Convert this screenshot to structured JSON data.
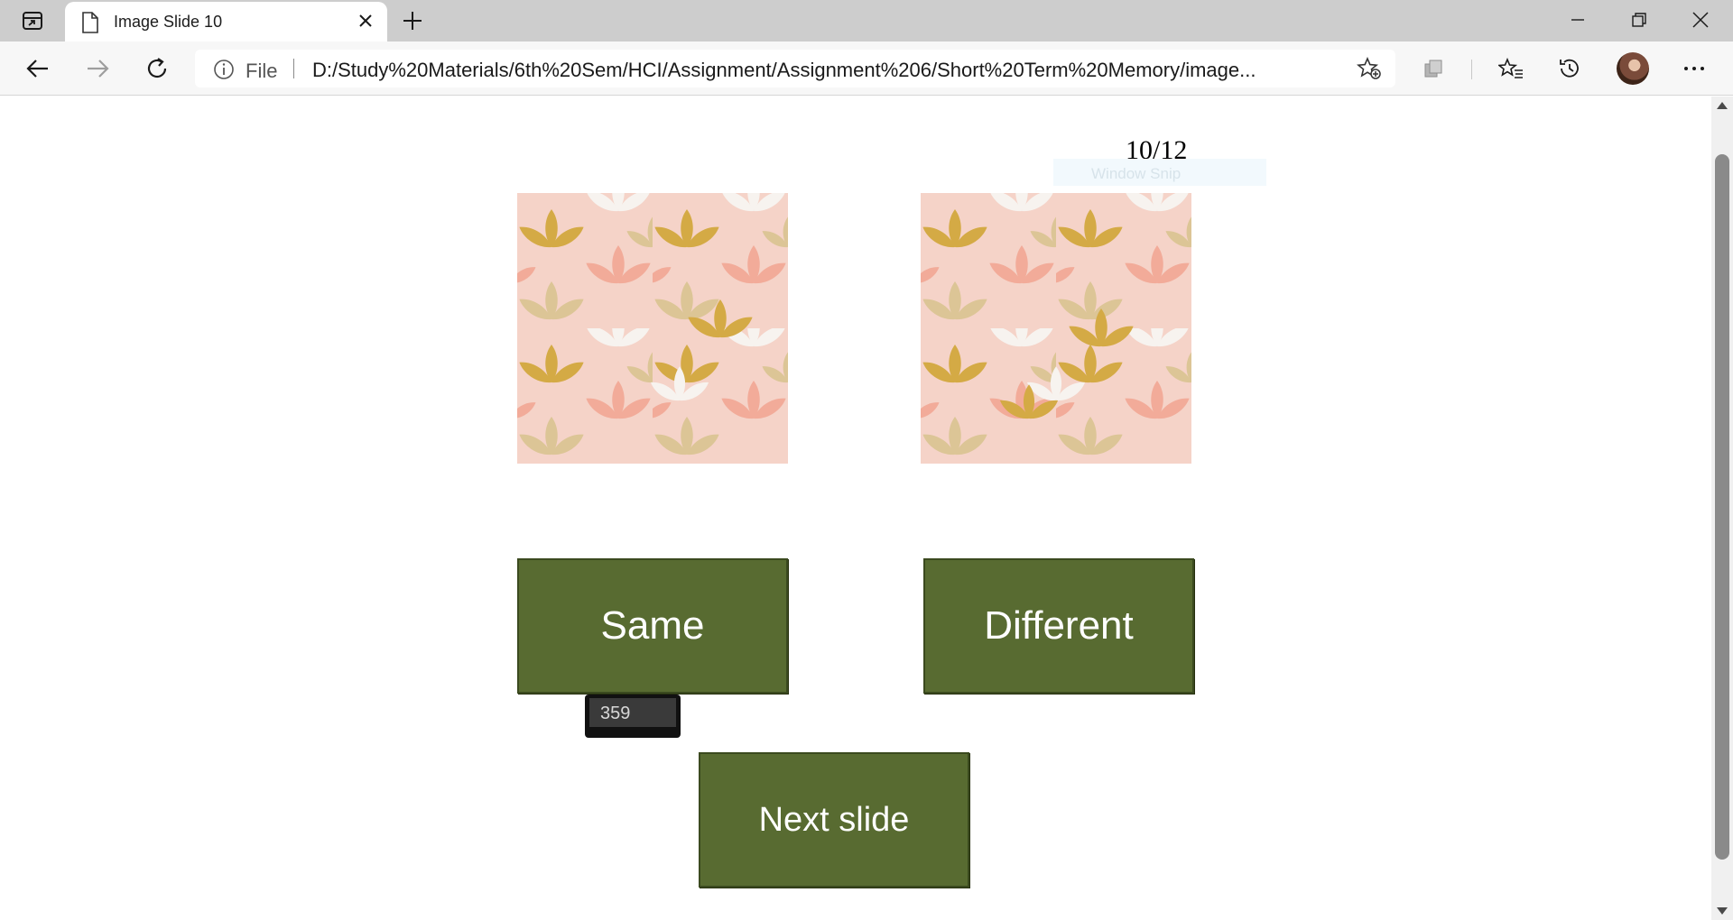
{
  "browser": {
    "tab": {
      "title": "Image Slide 10"
    },
    "address": {
      "scheme": "File",
      "url": "D:/Study%20Materials/6th%20Sem/HCI/Assignment/Assignment%206/Short%20Term%20Memory/image..."
    }
  },
  "page": {
    "counter": "10/12",
    "snip_overlay": "Window Snip",
    "images": [
      {
        "name": "left-pattern-image"
      },
      {
        "name": "right-pattern-image"
      }
    ],
    "buttons": {
      "same": "Same",
      "different": "Different",
      "next": "Next slide"
    },
    "tooltip_value": "359"
  },
  "colors": {
    "button_bg": "#586b31",
    "pattern_bg": "#f5d3c8",
    "leaf_gold": "#d4aa45",
    "leaf_tan": "#dcc596",
    "leaf_pink": "#f2ab99",
    "leaf_white": "#f7f3ef"
  }
}
